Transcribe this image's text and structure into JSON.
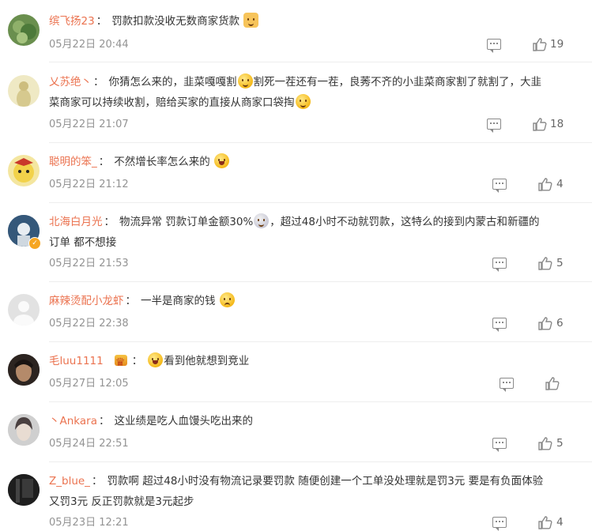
{
  "comments": [
    {
      "user": "缤飞扬23",
      "text": "罚款扣款没收无数商家货款",
      "emoji_after": "dog",
      "time": "05月22日 20:44",
      "likes": "19",
      "avatar_color": "#6a8f4e"
    },
    {
      "user": "乂苏绝丶",
      "text1": "你猜怎么来的，韭菜嘎嘎割",
      "text2": "割死一茬还有一茬，良莠不齐的小韭菜商家割了就割了，大韭",
      "text3": "菜商家可以持续收割，赔给买家的直接从商家口袋掏",
      "time": "05月22日 21:07",
      "likes": "18",
      "avatar_color": "#e9e2b8"
    },
    {
      "user": "聪明的笨_",
      "text": "不然增长率怎么来的",
      "time": "05月22日 21:12",
      "likes": "4",
      "avatar_color": "#c9392b"
    },
    {
      "user": "北海白月光",
      "text1": "物流异常 罚款订单金额30%",
      "text2": "，超过48小时不动就罚款，这特么的接到内蒙古和新疆的",
      "text3": "订单 都不想接",
      "time": "05月22日 21:53",
      "likes": "5",
      "avatar_color": "#3d5a7a"
    },
    {
      "user": "麻辣烫配小龙虾",
      "text": "一半是商家的钱",
      "time": "05月22日 22:38",
      "likes": "6",
      "avatar_color": "#d9d9d9"
    },
    {
      "user": "毛luu1111",
      "text": "看到他就想到竞业",
      "time": "05月27日 12:05",
      "likes": "",
      "avatar_color": "#4a3a32"
    },
    {
      "user": "丶Ankara",
      "text": "这业绩是吃人血馒头吃出来的",
      "time": "05月24日 22:51",
      "likes": "5",
      "avatar_color": "#9a9a9a"
    },
    {
      "user": "Z_blue_",
      "text1": "罚款啊 超过48小时没有物流记录要罚款 随便创建一个工单没处理就是罚3元 要是有负面体验",
      "text2": "又罚3元 反正罚款就是3元起步",
      "time": "05月23日 12:21",
      "likes": "4",
      "avatar_color": "#2b2b2b"
    }
  ],
  "separator": "："
}
